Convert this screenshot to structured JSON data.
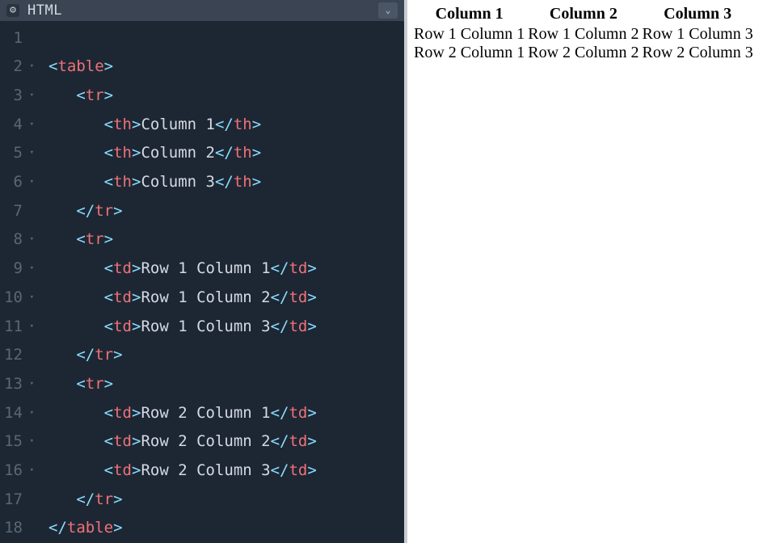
{
  "editor": {
    "title": "HTML",
    "lines": [
      {
        "num": "1",
        "fold": false,
        "indent": 0,
        "tokens": []
      },
      {
        "num": "2",
        "fold": true,
        "indent": 0,
        "tokens": [
          {
            "t": "bracket",
            "v": "<"
          },
          {
            "t": "tag",
            "v": "table"
          },
          {
            "t": "bracket",
            "v": ">"
          }
        ]
      },
      {
        "num": "3",
        "fold": true,
        "indent": 1,
        "tokens": [
          {
            "t": "bracket",
            "v": "<"
          },
          {
            "t": "tag",
            "v": "tr"
          },
          {
            "t": "bracket",
            "v": ">"
          }
        ]
      },
      {
        "num": "4",
        "fold": true,
        "indent": 2,
        "tokens": [
          {
            "t": "bracket",
            "v": "<"
          },
          {
            "t": "tag",
            "v": "th"
          },
          {
            "t": "bracket",
            "v": ">"
          },
          {
            "t": "text",
            "v": "Column 1"
          },
          {
            "t": "bracket",
            "v": "</"
          },
          {
            "t": "tag",
            "v": "th"
          },
          {
            "t": "bracket",
            "v": ">"
          }
        ]
      },
      {
        "num": "5",
        "fold": true,
        "indent": 2,
        "tokens": [
          {
            "t": "bracket",
            "v": "<"
          },
          {
            "t": "tag",
            "v": "th"
          },
          {
            "t": "bracket",
            "v": ">"
          },
          {
            "t": "text",
            "v": "Column 2"
          },
          {
            "t": "bracket",
            "v": "</"
          },
          {
            "t": "tag",
            "v": "th"
          },
          {
            "t": "bracket",
            "v": ">"
          }
        ]
      },
      {
        "num": "6",
        "fold": true,
        "indent": 2,
        "tokens": [
          {
            "t": "bracket",
            "v": "<"
          },
          {
            "t": "tag",
            "v": "th"
          },
          {
            "t": "bracket",
            "v": ">"
          },
          {
            "t": "text",
            "v": "Column 3"
          },
          {
            "t": "bracket",
            "v": "</"
          },
          {
            "t": "tag",
            "v": "th"
          },
          {
            "t": "bracket",
            "v": ">"
          }
        ]
      },
      {
        "num": "7",
        "fold": false,
        "indent": 1,
        "tokens": [
          {
            "t": "bracket",
            "v": "</"
          },
          {
            "t": "tag",
            "v": "tr"
          },
          {
            "t": "bracket",
            "v": ">"
          }
        ]
      },
      {
        "num": "8",
        "fold": true,
        "indent": 1,
        "tokens": [
          {
            "t": "bracket",
            "v": "<"
          },
          {
            "t": "tag",
            "v": "tr"
          },
          {
            "t": "bracket",
            "v": ">"
          }
        ]
      },
      {
        "num": "9",
        "fold": true,
        "indent": 2,
        "tokens": [
          {
            "t": "bracket",
            "v": "<"
          },
          {
            "t": "tag",
            "v": "td"
          },
          {
            "t": "bracket",
            "v": ">"
          },
          {
            "t": "text",
            "v": "Row 1 Column 1"
          },
          {
            "t": "bracket",
            "v": "</"
          },
          {
            "t": "tag",
            "v": "td"
          },
          {
            "t": "bracket",
            "v": ">"
          }
        ]
      },
      {
        "num": "10",
        "fold": true,
        "indent": 2,
        "tokens": [
          {
            "t": "bracket",
            "v": "<"
          },
          {
            "t": "tag",
            "v": "td"
          },
          {
            "t": "bracket",
            "v": ">"
          },
          {
            "t": "text",
            "v": "Row 1 Column 2"
          },
          {
            "t": "bracket",
            "v": "</"
          },
          {
            "t": "tag",
            "v": "td"
          },
          {
            "t": "bracket",
            "v": ">"
          }
        ]
      },
      {
        "num": "11",
        "fold": true,
        "indent": 2,
        "tokens": [
          {
            "t": "bracket",
            "v": "<"
          },
          {
            "t": "tag",
            "v": "td"
          },
          {
            "t": "bracket",
            "v": ">"
          },
          {
            "t": "text",
            "v": "Row 1 Column 3"
          },
          {
            "t": "bracket",
            "v": "</"
          },
          {
            "t": "tag",
            "v": "td"
          },
          {
            "t": "bracket",
            "v": ">"
          }
        ]
      },
      {
        "num": "12",
        "fold": false,
        "indent": 1,
        "tokens": [
          {
            "t": "bracket",
            "v": "</"
          },
          {
            "t": "tag",
            "v": "tr"
          },
          {
            "t": "bracket",
            "v": ">"
          }
        ]
      },
      {
        "num": "13",
        "fold": true,
        "indent": 1,
        "tokens": [
          {
            "t": "bracket",
            "v": "<"
          },
          {
            "t": "tag",
            "v": "tr"
          },
          {
            "t": "bracket",
            "v": ">"
          }
        ]
      },
      {
        "num": "14",
        "fold": true,
        "indent": 2,
        "tokens": [
          {
            "t": "bracket",
            "v": "<"
          },
          {
            "t": "tag",
            "v": "td"
          },
          {
            "t": "bracket",
            "v": ">"
          },
          {
            "t": "text",
            "v": "Row 2 Column 1"
          },
          {
            "t": "bracket",
            "v": "</"
          },
          {
            "t": "tag",
            "v": "td"
          },
          {
            "t": "bracket",
            "v": ">"
          }
        ]
      },
      {
        "num": "15",
        "fold": true,
        "indent": 2,
        "tokens": [
          {
            "t": "bracket",
            "v": "<"
          },
          {
            "t": "tag",
            "v": "td"
          },
          {
            "t": "bracket",
            "v": ">"
          },
          {
            "t": "text",
            "v": "Row 2 Column 2"
          },
          {
            "t": "bracket",
            "v": "</"
          },
          {
            "t": "tag",
            "v": "td"
          },
          {
            "t": "bracket",
            "v": ">"
          }
        ]
      },
      {
        "num": "16",
        "fold": true,
        "indent": 2,
        "tokens": [
          {
            "t": "bracket",
            "v": "<"
          },
          {
            "t": "tag",
            "v": "td"
          },
          {
            "t": "bracket",
            "v": ">"
          },
          {
            "t": "text",
            "v": "Row 2 Column 3"
          },
          {
            "t": "bracket",
            "v": "</"
          },
          {
            "t": "tag",
            "v": "td"
          },
          {
            "t": "bracket",
            "v": ">"
          }
        ]
      },
      {
        "num": "17",
        "fold": false,
        "indent": 1,
        "tokens": [
          {
            "t": "bracket",
            "v": "</"
          },
          {
            "t": "tag",
            "v": "tr"
          },
          {
            "t": "bracket",
            "v": ">"
          }
        ]
      },
      {
        "num": "18",
        "fold": false,
        "indent": 0,
        "tokens": [
          {
            "t": "bracket",
            "v": "</"
          },
          {
            "t": "tag",
            "v": "table"
          },
          {
            "t": "bracket",
            "v": ">"
          }
        ]
      }
    ]
  },
  "preview": {
    "headers": [
      "Column 1",
      "Column 2",
      "Column 3"
    ],
    "rows": [
      [
        "Row 1 Column 1",
        "Row 1 Column 2",
        "Row 1 Column 3"
      ],
      [
        "Row 2 Column 1",
        "Row 2 Column 2",
        "Row 2 Column 3"
      ]
    ]
  }
}
